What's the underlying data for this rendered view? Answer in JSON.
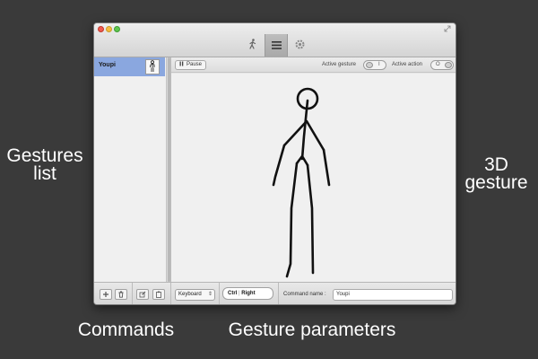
{
  "callouts": {
    "gestures_list": [
      "Gestures",
      "list"
    ],
    "gesture_3d": [
      "3D",
      "gesture"
    ],
    "commands": "Commands",
    "gesture_parameters": "Gesture parameters"
  },
  "toolbar": {
    "items": [
      {
        "icon": "walking-figure-icon",
        "active": false
      },
      {
        "icon": "list-icon",
        "active": true
      },
      {
        "icon": "gear-icon",
        "active": false
      }
    ]
  },
  "sidebar": {
    "items": [
      {
        "label": "Youpi",
        "selected": true,
        "thumbnail_icon": "stick-figure-icon"
      }
    ]
  },
  "main_bar": {
    "pause_label": "Pause",
    "active_gesture_label": "Active gesture",
    "active_gesture_toggle_mark": "I",
    "active_action_label": "Active action",
    "active_action_toggle_mark": "O"
  },
  "bottombar": {
    "command_buttons": [
      "add-icon",
      "trash-icon",
      "edit-icon",
      "paste-icon"
    ],
    "command_type_value": "Keyboard",
    "keys": [
      "Ctrl",
      "Right"
    ],
    "command_name_label": "Command name :",
    "command_name_value": "Youpi"
  },
  "colors": {
    "desktop_bg": "#3a3a3a",
    "selection": "#8aa7df",
    "canvas_bg": "#f0f0f0",
    "figure_stroke": "#111111"
  }
}
